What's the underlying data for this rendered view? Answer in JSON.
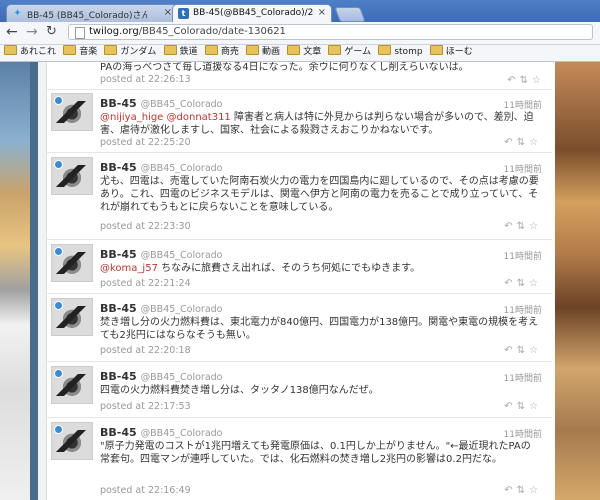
{
  "browser": {
    "tabs": [
      {
        "title": "BB-45 (BB45_Colorado)さん",
        "icon": "twitter-bird-icon",
        "active": false
      },
      {
        "title": "BB-45(@BB45_Colorado)/2",
        "icon": "twilog-icon",
        "active": true
      }
    ],
    "url_domain": "twilog.org",
    "url_path": "/BB45_Colorado/date-130621",
    "bookmarks": [
      "あれこれ",
      "音楽",
      "ガンダム",
      "鉄道",
      "商売",
      "動画",
      "文章",
      "ゲーム",
      "stomp",
      "ほーむ"
    ]
  },
  "partial_tweet": {
    "text": "PAの海っべつさて毎し道援なる4日になった。余ウに何りなくし削えらいないは。",
    "posted": "posted at 22:26:13"
  },
  "tweets": [
    {
      "user": "BB-45",
      "handle": "@BB45_Colorado",
      "ago": "11時間前",
      "mentions": "@nijiya_hige @donnat311",
      "text": " 障害者と病人は特に外見からは判らない場合が多いので、差別、迫害、虐待が激化しますし、国家、社会による殺戮さえおこりかねないです。",
      "posted": "posted at 22:25:20"
    },
    {
      "user": "BB-45",
      "handle": "@BB45_Colorado",
      "ago": "11時間前",
      "mentions": "",
      "text": "尤も、四電は、売電していた阿南石炭火力の電力を四国島内に廻しているので、その点は考慮の要あり。これ、四電のビジネスモデルは、関電へ伊方と阿南の電力を売ることで成り立っていて、それが崩れてもうもとに戻らないことを意味している。",
      "posted": "posted at 22:23:30"
    },
    {
      "user": "BB-45",
      "handle": "@BB45_Colorado",
      "ago": "11時間前",
      "mentions": "@koma_j57",
      "text": " ちなみに旅費さえ出れば、そのうち何処にでもゆきます。",
      "posted": "posted at 22:21:24"
    },
    {
      "user": "BB-45",
      "handle": "@BB45_Colorado",
      "ago": "11時間前",
      "mentions": "",
      "text": "焚き増し分の火力燃料費は、東北電力が840億円、四国電力が138億円。関電や東電の規模を考えても2兆円にはならなそうも無い。",
      "posted": "posted at 22:20:18"
    },
    {
      "user": "BB-45",
      "handle": "@BB45_Colorado",
      "ago": "11時間前",
      "mentions": "",
      "text": "四電の火力燃料費焚き増し分は、タッタノ138億円なんだぜ。",
      "posted": "posted at 22:17:53"
    },
    {
      "user": "BB-45",
      "handle": "@BB45_Colorado",
      "ago": "11時間前",
      "mentions": "",
      "text": "\"原子力発電のコストが1兆円増えても発電原価は、0.1円しか上がりません。\"←最近現れたPAの常套句。四電マンが連呼していた。では、化石燃料の焚き増し2兆円の影響は0.2円だな。",
      "posted": "posted at 22:16:49"
    }
  ],
  "actions": [
    "reply-icon",
    "retweet-icon",
    "favorite-icon"
  ]
}
